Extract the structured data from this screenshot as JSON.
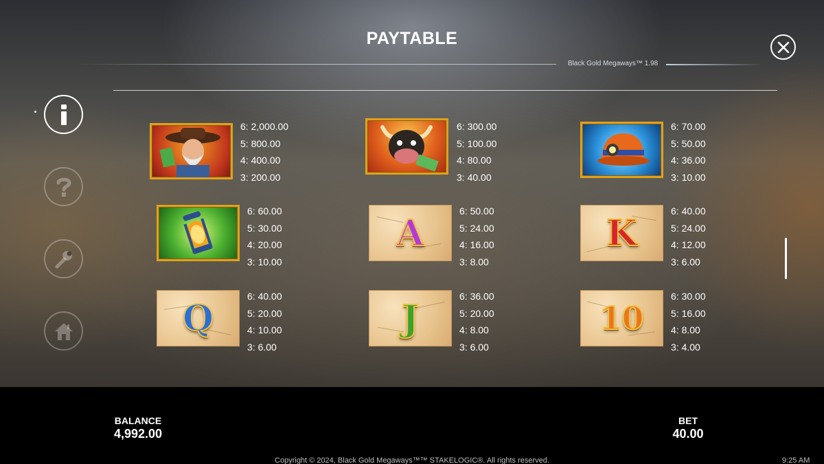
{
  "header": {
    "title": "PAYTABLE",
    "version": "Black Gold Megaways™ 1.98"
  },
  "close_icon": "close-icon",
  "nav": [
    {
      "icon": "info-icon",
      "active": true
    },
    {
      "icon": "help-icon",
      "active": false
    },
    {
      "icon": "settings-wrench-icon",
      "active": false
    },
    {
      "icon": "home-icon",
      "active": false
    }
  ],
  "symbols": [
    {
      "name": "prospector",
      "pays": [
        "6: 2,000.00",
        "5: 800.00",
        "4: 400.00",
        "3: 200.00"
      ]
    },
    {
      "name": "bull",
      "pays": [
        "6: 300.00",
        "5: 100.00",
        "4: 80.00",
        "3: 40.00"
      ]
    },
    {
      "name": "miner-helmet",
      "pays": [
        "6: 70.00",
        "5: 50.00",
        "4: 36.00",
        "3: 10.00"
      ]
    },
    {
      "name": "lantern",
      "pays": [
        "6: 60.00",
        "5: 30.00",
        "4: 20.00",
        "3: 10.00"
      ]
    },
    {
      "name": "letter-a",
      "glyph": "A",
      "color": "#b43ad6",
      "pays": [
        "6: 50.00",
        "5: 24.00",
        "4: 16.00",
        "3: 8.00"
      ]
    },
    {
      "name": "letter-k",
      "glyph": "K",
      "color": "#d7262a",
      "pays": [
        "6: 40.00",
        "5: 24.00",
        "4: 12.00",
        "3: 6.00"
      ]
    },
    {
      "name": "letter-q",
      "glyph": "Q",
      "color": "#2a6fd8",
      "pays": [
        "6: 40.00",
        "5: 20.00",
        "4: 10.00",
        "3: 6.00"
      ]
    },
    {
      "name": "letter-j",
      "glyph": "J",
      "color": "#3aa22e",
      "pays": [
        "6: 36.00",
        "5: 20.00",
        "4: 8.00",
        "3: 6.00"
      ]
    },
    {
      "name": "number-10",
      "glyph": "10",
      "color": "#e8771c",
      "pays": [
        "6: 30.00",
        "5: 16.00",
        "4: 8.00",
        "3: 4.00"
      ]
    }
  ],
  "footer": {
    "balance_label": "BALANCE",
    "balance_value": "4,992.00",
    "bet_label": "BET",
    "bet_value": "40.00",
    "copyright": "Copyright © 2024, Black Gold Megaways™™ STAKELOGIC®. All rights reserved.",
    "clock": "9:25 AM"
  }
}
